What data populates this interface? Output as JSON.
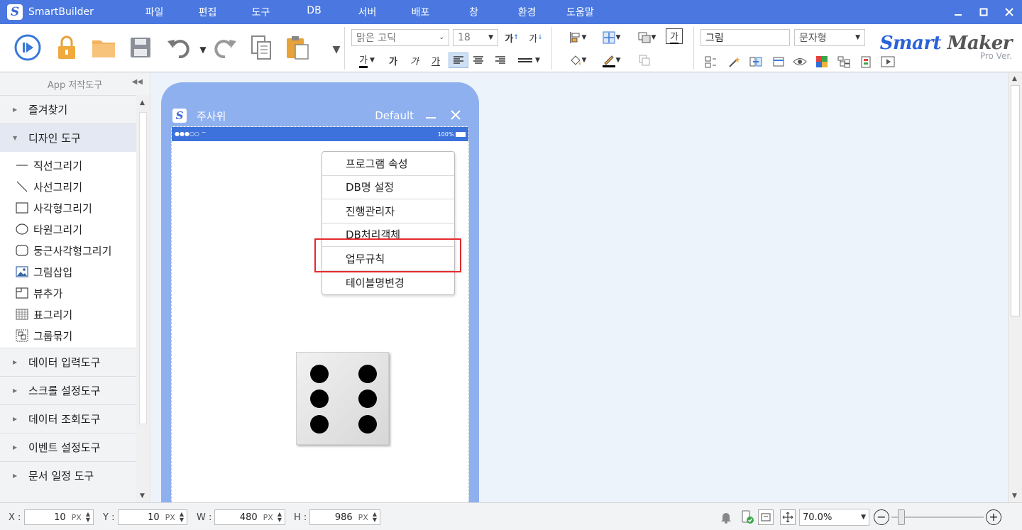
{
  "app": {
    "title": "SmartBuilder"
  },
  "menu": [
    "파일",
    "편집",
    "도구",
    "DB",
    "서버",
    "배포",
    "창",
    "환경",
    "도움말"
  ],
  "toolbar": {
    "font_name": "맑은 고딕",
    "font_size": "18",
    "shape_name": "그림",
    "text_type": "문자형",
    "brand_main_a": "Smart",
    "brand_main_b": "Maker",
    "brand_sub": "Pro Ver.",
    "glyph_text": "가",
    "glyph_bold": "가",
    "glyph_italic": "가",
    "glyph_underline": "가",
    "glyph_up": "가",
    "glyph_down": "가"
  },
  "panel": {
    "title": "App 저작도구",
    "categories": {
      "favorites": "즐겨찾기",
      "design_tools": "디자인 도구",
      "data_input": "데이터 입력도구",
      "scroll_setting": "스크롤 설정도구",
      "data_query": "데이터 조회도구",
      "event_setting": "이벤트 설정도구",
      "doc_schedule": "문서 일정 도구"
    },
    "tools": [
      "직선그리기",
      "사선그리기",
      "사각형그리기",
      "타원그리기",
      "둥근사각형그리기",
      "그림삽입",
      "뷰추가",
      "표그리기",
      "그룹묶기"
    ]
  },
  "phone": {
    "title": "주사위",
    "theme": "Default",
    "status_left": "●●●○○",
    "status_right": "100%"
  },
  "context_menu": [
    "프로그램 속성",
    "DB명 설정",
    "진행관리자",
    "DB처리객체",
    "업무규칙",
    "테이블명변경"
  ],
  "statusbar": {
    "x_label": "X :",
    "x_value": "10",
    "y_label": "Y :",
    "y_value": "10",
    "w_label": "W :",
    "w_value": "480",
    "h_label": "H :",
    "h_value": "986",
    "unit": "PX",
    "zoom": "70.0%"
  },
  "colors": {
    "titlebar": "#4a78e0",
    "highlight": "#e52b2b",
    "phone_frame": "#8fb0ef",
    "status": "#3d72dc"
  }
}
